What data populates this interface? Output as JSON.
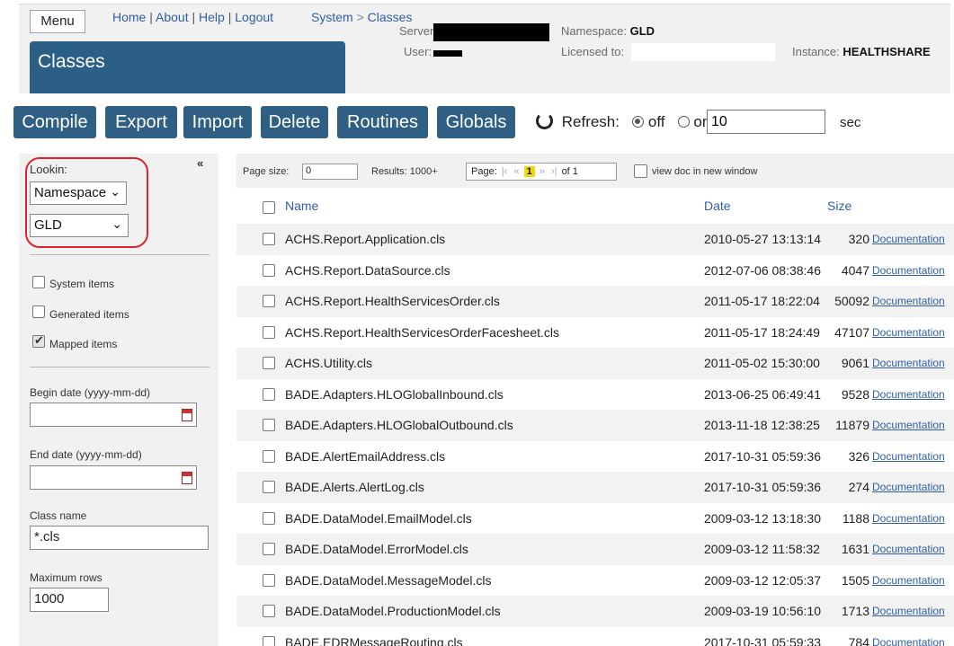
{
  "header": {
    "menu_label": "Menu",
    "links": [
      "Home",
      "About",
      "Help",
      "Logout"
    ],
    "link_separator": "|",
    "breadcrumb": {
      "root": "System",
      "separator": ">",
      "current": "Classes"
    },
    "title": "Classes",
    "server_label": "Server:",
    "user_label": "User:",
    "namespace_label": "Namespace:",
    "namespace_value": "GLD",
    "licensed_label": "Licensed to:",
    "instance_label": "Instance:",
    "instance_value": "HEALTHSHARE"
  },
  "toolbar": {
    "buttons": [
      "Compile",
      "Export",
      "Import",
      "Delete",
      "Routines",
      "Globals"
    ],
    "refresh_label": "Refresh:",
    "off_label": "off",
    "on_label": "on",
    "refresh_selected": "off",
    "interval_value": "10",
    "sec_label": "sec"
  },
  "sidebar": {
    "collapse_icon": "«",
    "lookin_label": "Lookin:",
    "lookin_select": "Namespace",
    "namespace_select": "GLD",
    "system_items": {
      "label": "System items",
      "checked": false
    },
    "generated_items": {
      "label": "Generated items",
      "checked": false
    },
    "mapped_items": {
      "label": "Mapped items",
      "checked": true
    },
    "begin_date_label": "Begin date (yyyy-mm-dd)",
    "begin_date_value": "",
    "end_date_label": "End date (yyyy-mm-dd)",
    "end_date_value": "",
    "class_name_label": "Class name",
    "class_name_value": "*.cls",
    "max_rows_label": "Maximum rows",
    "max_rows_value": "1000"
  },
  "pager": {
    "page_size_label": "Page size:",
    "page_size_value": "0",
    "results_label": "Results: 1000+",
    "page_label": "Page:",
    "current_page": "1",
    "of_label": "of 1",
    "view_doc_label": "view doc in new window"
  },
  "table": {
    "columns": {
      "name": "Name",
      "date": "Date",
      "size": "Size"
    },
    "doc_label": "Documentation",
    "rows": [
      {
        "name": "ACHS.Report.Application.cls",
        "date": "2010-05-27 13:13:14",
        "size": "320"
      },
      {
        "name": "ACHS.Report.DataSource.cls",
        "date": "2012-07-06 08:38:46",
        "size": "4047"
      },
      {
        "name": "ACHS.Report.HealthServicesOrder.cls",
        "date": "2011-05-17 18:22:04",
        "size": "50092"
      },
      {
        "name": "ACHS.Report.HealthServicesOrderFacesheet.cls",
        "date": "2011-05-17 18:24:49",
        "size": "47107"
      },
      {
        "name": "ACHS.Utility.cls",
        "date": "2011-05-02 15:30:00",
        "size": "9061"
      },
      {
        "name": "BADE.Adapters.HLOGlobalInbound.cls",
        "date": "2013-06-25 06:49:41",
        "size": "9528"
      },
      {
        "name": "BADE.Adapters.HLOGlobalOutbound.cls",
        "date": "2013-11-18 12:38:25",
        "size": "11879"
      },
      {
        "name": "BADE.AlertEmailAddress.cls",
        "date": "2017-10-31 05:59:36",
        "size": "326"
      },
      {
        "name": "BADE.Alerts.AlertLog.cls",
        "date": "2017-10-31 05:59:36",
        "size": "274"
      },
      {
        "name": "BADE.DataModel.EmailModel.cls",
        "date": "2009-03-12 13:18:30",
        "size": "1188"
      },
      {
        "name": "BADE.DataModel.ErrorModel.cls",
        "date": "2009-03-12 11:58:32",
        "size": "1631"
      },
      {
        "name": "BADE.DataModel.MessageModel.cls",
        "date": "2009-03-12 12:05:37",
        "size": "1505"
      },
      {
        "name": "BADE.DataModel.ProductionModel.cls",
        "date": "2009-03-19 10:56:10",
        "size": "1713"
      },
      {
        "name": "BADE.EDRMessageRouting.cls",
        "date": "2017-10-31 05:59:33",
        "size": "784"
      }
    ]
  }
}
